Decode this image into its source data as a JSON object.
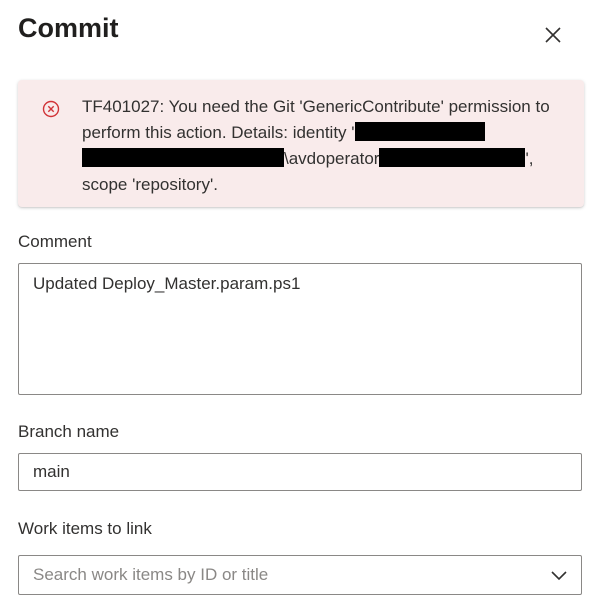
{
  "dialog": {
    "title": "Commit",
    "close_icon": "close-icon"
  },
  "error": {
    "icon": "error-circle-icon",
    "line1": "TF401027: You need the Git 'GenericContribute' permission to perform this action. Details: identity '",
    "line2_mid": "\\avdoperator",
    "line2_end": "',",
    "line3": "scope 'repository'."
  },
  "comment": {
    "label": "Comment",
    "value": "Updated Deploy_Master.param.ps1"
  },
  "branch": {
    "label": "Branch name",
    "value": "main"
  },
  "work_items": {
    "label": "Work items to link",
    "placeholder": "Search work items by ID or title",
    "chevron_icon": "chevron-down-icon"
  },
  "colors": {
    "error_background": "#f9ebeb",
    "error_icon": "#d13438",
    "border": "#8a8886",
    "text": "#323130"
  }
}
